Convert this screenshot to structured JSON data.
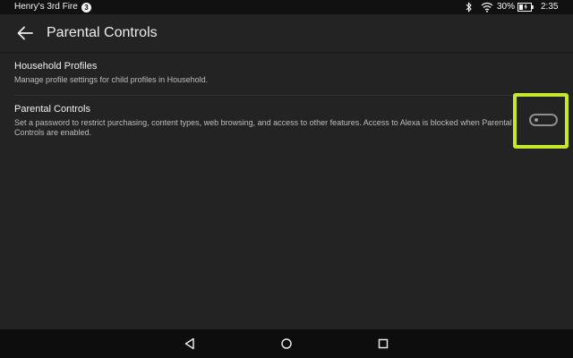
{
  "status_bar": {
    "device_name": "Henry's 3rd Fire",
    "notification_count": "3",
    "battery_percent": "30%",
    "time": "2:35",
    "icons": [
      "bluetooth-icon",
      "wifi-icon",
      "battery-charging-icon"
    ]
  },
  "app_bar": {
    "title": "Parental Controls",
    "back_icon": "back-arrow-icon"
  },
  "settings": {
    "household": {
      "title": "Household Profiles",
      "description": "Manage profile settings for child profiles in Household."
    },
    "parental": {
      "title": "Parental Controls",
      "description": "Set a password to restrict purchasing, content types, web browsing, and access to other features. Access to Alexa is blocked when Parental Controls are enabled.",
      "toggle_on": false
    }
  },
  "nav_bar": {
    "icons": [
      "nav-back-icon",
      "nav-home-icon",
      "nav-recent-icon"
    ]
  },
  "colors": {
    "background": "#232323",
    "status_bar": "#111111",
    "nav_bar": "#0d0d0d",
    "highlight": "#c6e82c",
    "text_primary": "#f0f0f0",
    "text_secondary": "#bdbdbd"
  }
}
